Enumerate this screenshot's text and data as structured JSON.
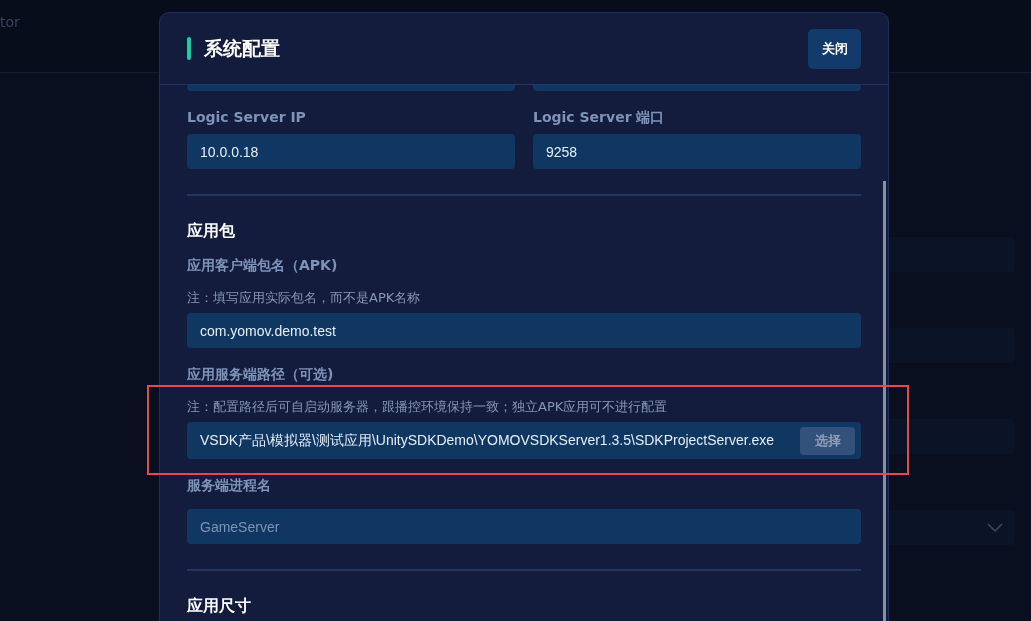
{
  "background": {
    "header_text": "tor",
    "fields": [
      {
        "kind": "field"
      },
      {
        "kind": "field"
      },
      {
        "kind": "field"
      },
      {
        "kind": "select"
      }
    ]
  },
  "dialog": {
    "title": "系统配置",
    "close_button": "关闭",
    "server_row": [
      {
        "label": "Logic Server IP",
        "value": "10.0.0.18"
      },
      {
        "label": "Logic Server 端口",
        "value": "9258"
      }
    ],
    "sections": [
      {
        "title": "应用包",
        "fields": [
          {
            "label": "应用客户端包名（APK)",
            "note": "注：填写应用实际包名，而不是APK名称",
            "value": "com.yomov.demo.test",
            "disabled": false
          },
          {
            "label": "应用服务端路径（可选)",
            "note": "注：配置路径后可自启动服务器，跟播控环境保持一致；独立APK应用可不进行配置",
            "value": "VSDK产品\\模拟器\\测试应用\\UnitySDKDemo\\YOMOVSDKServer1.3.5\\SDKProjectServer.exe",
            "button": {
              "label": "选择",
              "disabled": true
            },
            "disabled": false
          },
          {
            "label": "服务端进程名",
            "value": "GameServer",
            "disabled": true
          }
        ]
      },
      {
        "title": "应用尺寸"
      }
    ]
  }
}
